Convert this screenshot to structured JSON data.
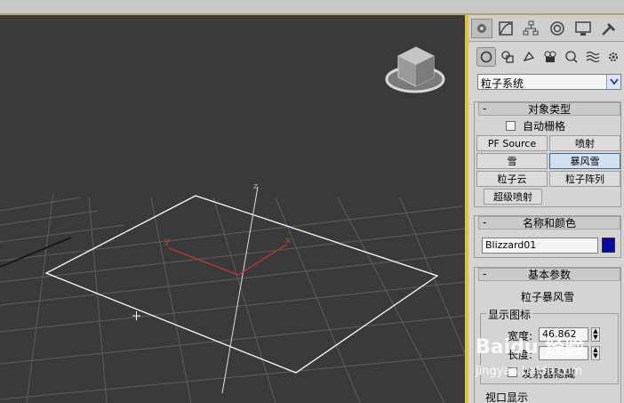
{
  "panel": {
    "category_dropdown": "粒子系统",
    "object_type": {
      "title": "对象类型",
      "autogrid": "自动栅格",
      "buttons": [
        "PF Source",
        "喷射",
        "雪",
        "暴风雪",
        "粒子云",
        "粒子阵列",
        "超级喷射"
      ],
      "active": "暴风雪"
    },
    "name_color": {
      "title": "名称和颜色",
      "name": "Blizzard01",
      "color": "#0a0aa0"
    },
    "basic_params": {
      "title": "基本参数",
      "subtitle": "粒子暴风雪",
      "display_icon_group": "显示图标",
      "width_label": "宽度:",
      "width_value": "46.862",
      "length_label": "长度:",
      "hide_label": "发射器隐藏",
      "viewport_display_group": "视口显示"
    }
  },
  "viewport": {
    "axis_x": "x",
    "axis_y": "y",
    "axis_z": "z"
  },
  "watermark": {
    "brand": "Baidu 经验",
    "url": "jingyan.baidu.com"
  }
}
